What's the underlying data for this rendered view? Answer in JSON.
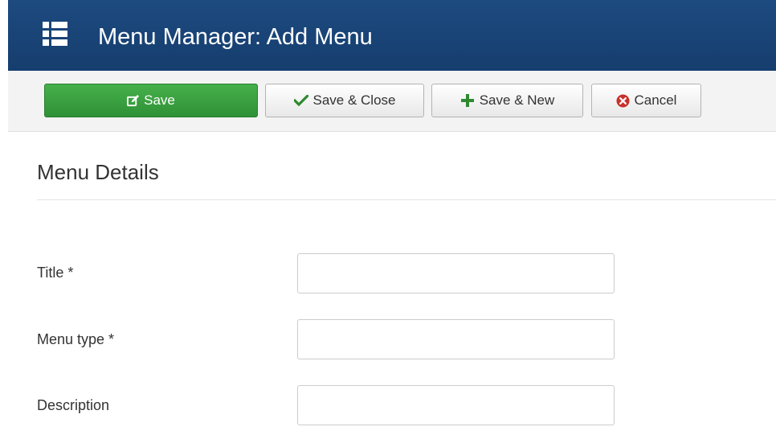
{
  "header": {
    "title": "Menu Manager: Add Menu",
    "icon": "list-icon",
    "background_color": "#1d4a80"
  },
  "toolbar": {
    "save_label": "Save",
    "save_icon": "edit-icon",
    "save_close_label": "Save & Close",
    "save_close_icon": "check-icon",
    "save_new_label": "Save & New",
    "save_new_icon": "plus-icon",
    "cancel_label": "Cancel",
    "cancel_icon": "cancel-circle-icon",
    "save_color": "#3da543",
    "check_color": "#2f8a2f",
    "plus_color": "#2f8a2f",
    "cancel_color": "#c9302c"
  },
  "form": {
    "section_title": "Menu Details",
    "fields": [
      {
        "label": "Title *",
        "value": "",
        "placeholder": ""
      },
      {
        "label": "Menu type *",
        "value": "",
        "placeholder": ""
      },
      {
        "label": "Description",
        "value": "",
        "placeholder": ""
      }
    ]
  }
}
